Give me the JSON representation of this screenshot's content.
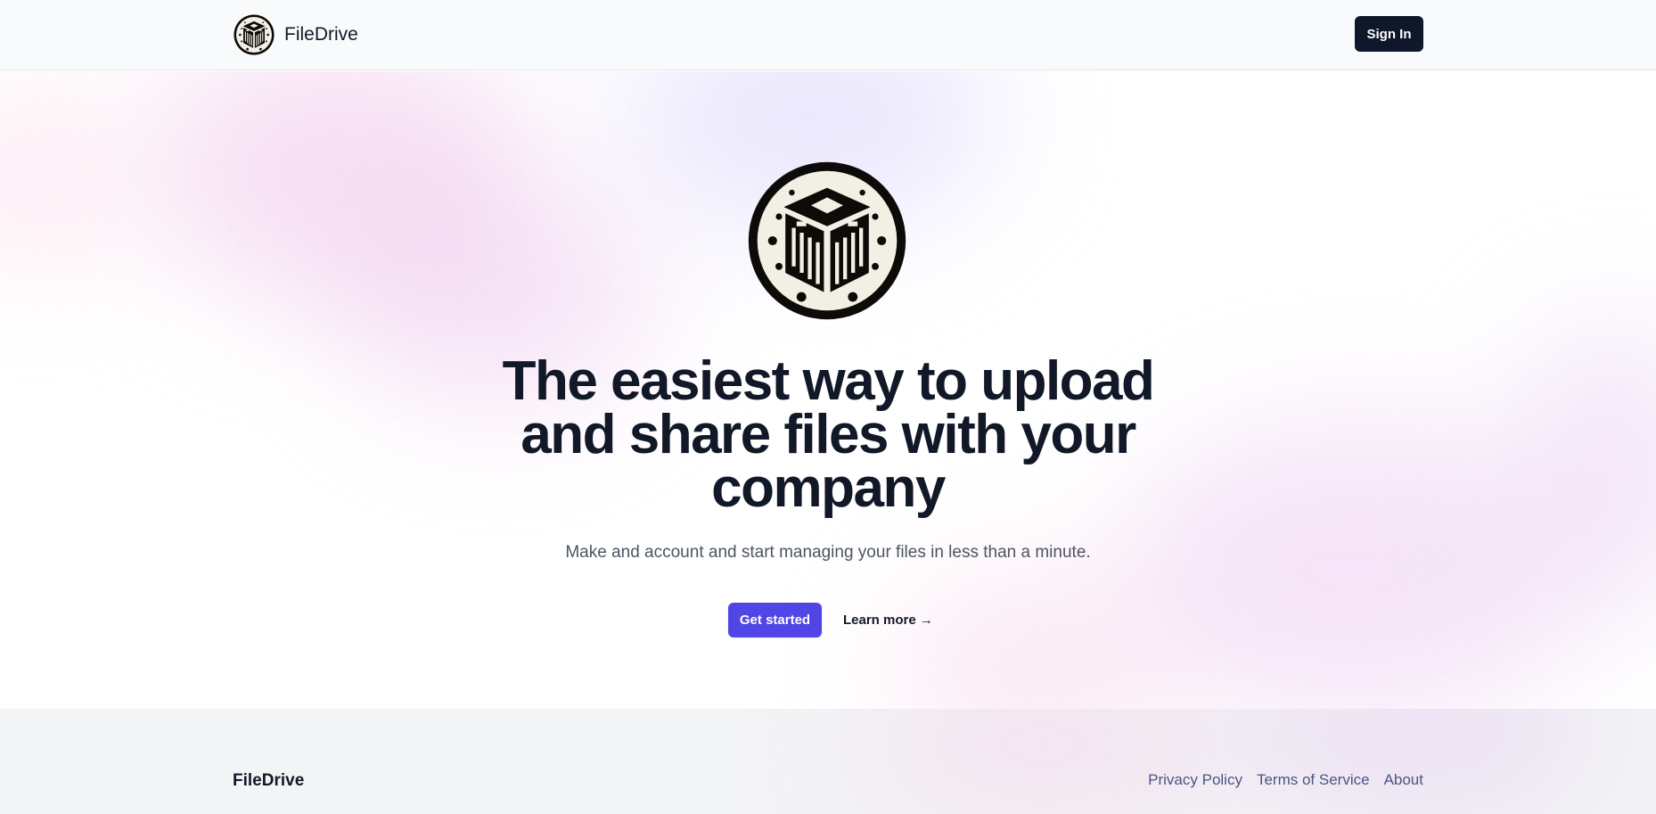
{
  "header": {
    "brand_name": "FileDrive",
    "logo_icon": "circuit-box-logo-icon",
    "sign_in_label": "Sign In"
  },
  "hero": {
    "logo_icon": "circuit-box-logo-icon",
    "headline": "The easiest way to upload and share files with your company",
    "subtitle": "Make and account and start managing your files in less than a minute.",
    "primary_cta": "Get started",
    "secondary_cta": "Learn more →"
  },
  "footer": {
    "brand_name": "FileDrive",
    "links": [
      "Privacy Policy",
      "Terms of Service",
      "About"
    ]
  },
  "colors": {
    "primary": "#4f46e5",
    "dark": "#0f172a",
    "text": "#111827",
    "muted": "#4b5563",
    "header_bg": "#f9fafb",
    "footer_bg": "#f3f4f6",
    "footer_link": "#4b5583"
  }
}
